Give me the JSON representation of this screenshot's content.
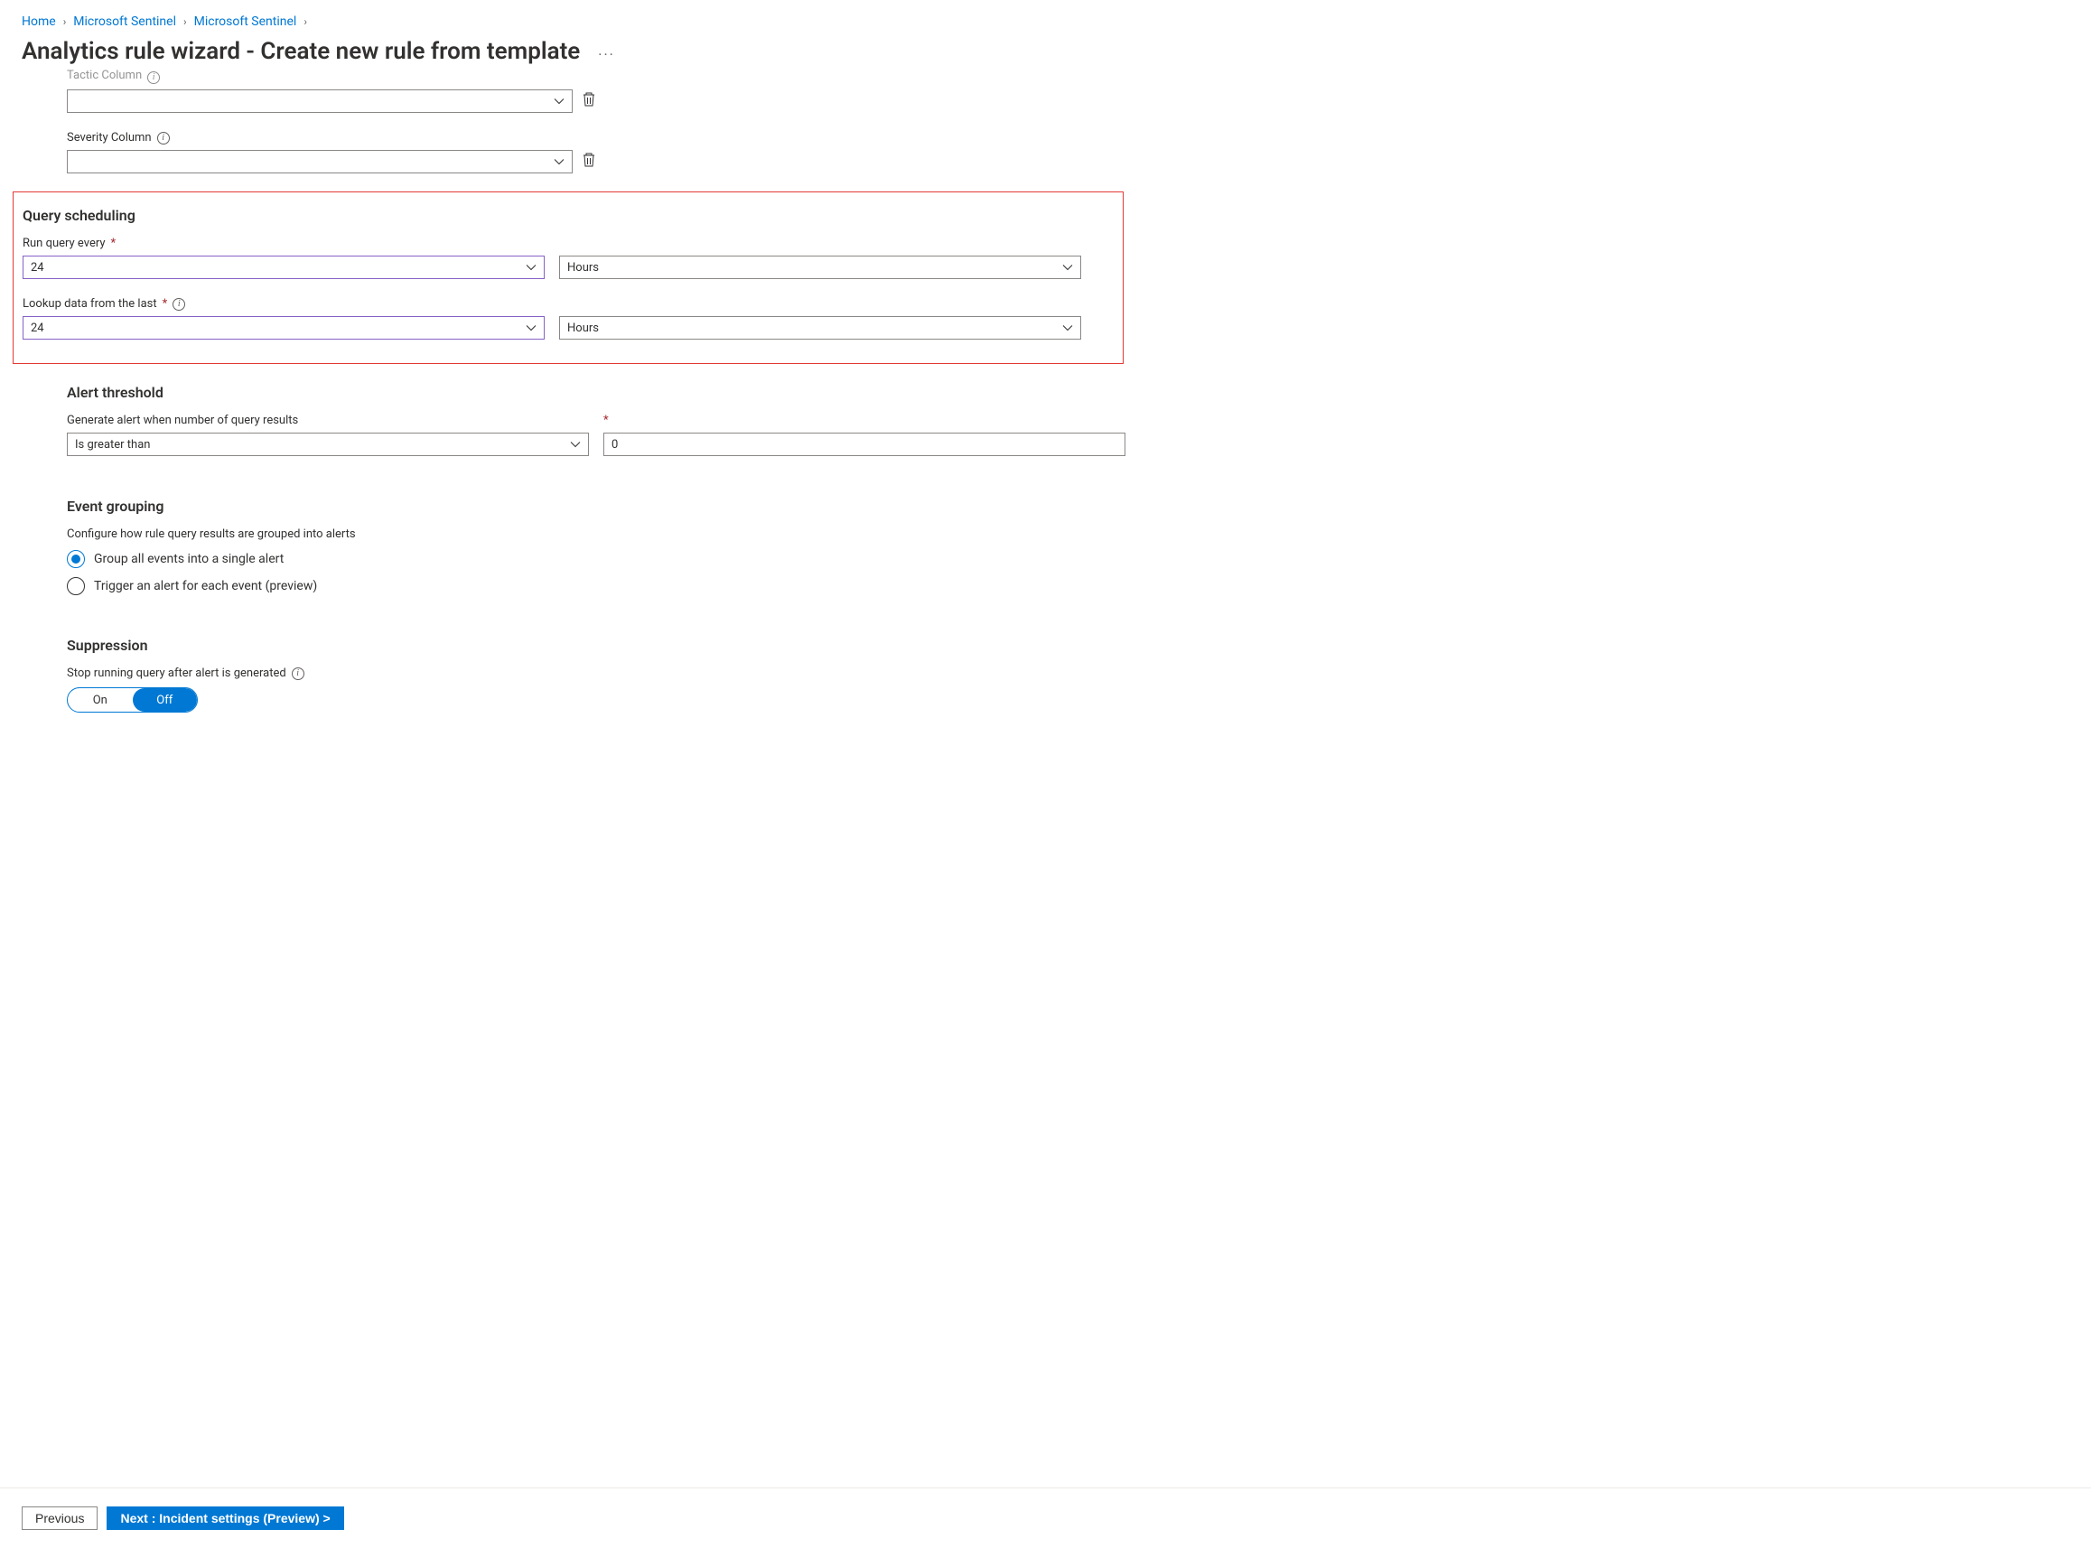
{
  "breadcrumb": {
    "items": [
      "Home",
      "Microsoft Sentinel",
      "Microsoft Sentinel"
    ]
  },
  "page": {
    "title": "Analytics rule wizard - Create new rule from template"
  },
  "top_fields": {
    "tactic": {
      "label": "Tactic Column",
      "value": ""
    },
    "severity": {
      "label": "Severity Column",
      "value": ""
    }
  },
  "scheduling": {
    "title": "Query scheduling",
    "run_label": "Run query every",
    "run_value": "24",
    "run_unit": "Hours",
    "lookup_label": "Lookup data from the last",
    "lookup_value": "24",
    "lookup_unit": "Hours"
  },
  "threshold": {
    "title": "Alert threshold",
    "label": "Generate alert when number of query results",
    "operator": "Is greater than",
    "value": "0"
  },
  "grouping": {
    "title": "Event grouping",
    "desc": "Configure how rule query results are grouped into alerts",
    "opt1": "Group all events into a single alert",
    "opt2": "Trigger an alert for each event (preview)"
  },
  "suppression": {
    "title": "Suppression",
    "label": "Stop running query after alert is generated",
    "on": "On",
    "off": "Off"
  },
  "footer": {
    "prev": "Previous",
    "next": "Next : Incident settings (Preview) >"
  }
}
